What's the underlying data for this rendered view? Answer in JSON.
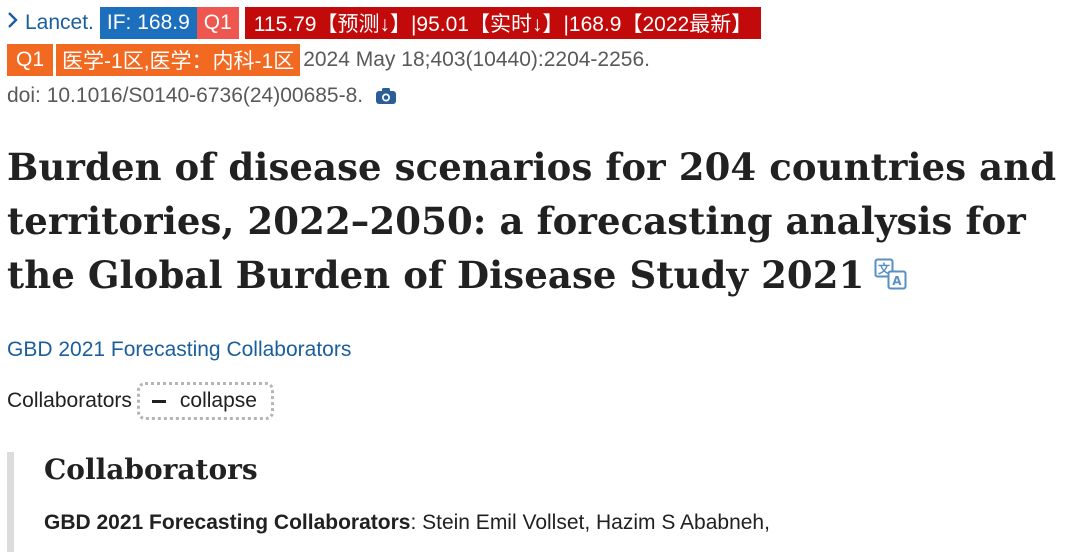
{
  "journal": {
    "name": "Lancet.",
    "if_badge": "IF: 168.9",
    "quartile": "Q1",
    "metrics": "115.79【预测↓】|95.01【实时↓】|168.9【2022最新】",
    "cas_quartile": "Q1",
    "cas_zone": "医学-1区,医学：内科-1区"
  },
  "citation": {
    "date_volume": "2024 May 18;403(10440):2204-2256.",
    "doi": "doi: 10.1016/S0140-6736(24)00685-8."
  },
  "article": {
    "title": "Burden of disease scenarios for 204 countries and territories, 2022–2050: a forecasting analysis for the Global Burden of Disease Study 2021",
    "authors": "GBD 2021 Forecasting Collaborators"
  },
  "collaborators": {
    "label": "Collaborators",
    "collapse_label": "collapse",
    "heading": "Collaborators",
    "group_name": "GBD 2021 Forecasting Collaborators",
    "names_start": ": Stein Emil Vollset, Hazim S Ababneh,"
  },
  "icons": {
    "chevron": "chevron-right-icon",
    "camera": "camera-icon",
    "translate": "translate-icon",
    "minus": "minus-icon"
  },
  "colors": {
    "link": "#1a5f9c",
    "if_badge": "#1c6fbd",
    "q1_red": "#f05650",
    "metric_badge": "#c20a0a",
    "orange_badge": "#f26922"
  }
}
